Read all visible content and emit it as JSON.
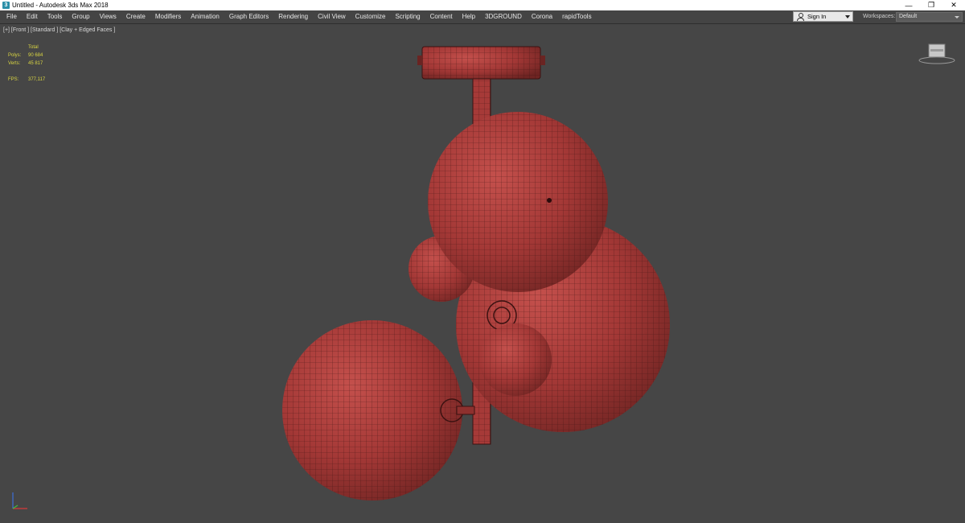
{
  "window": {
    "title": "Untitled - Autodesk 3ds Max 2018",
    "icon": "3ds-max-app-icon",
    "controls": [
      "minimize",
      "restore",
      "close"
    ]
  },
  "menubar": {
    "items": [
      "File",
      "Edit",
      "Tools",
      "Group",
      "Views",
      "Create",
      "Modifiers",
      "Animation",
      "Graph Editors",
      "Rendering",
      "Civil View",
      "Customize",
      "Scripting",
      "Content",
      "Help",
      "3DGROUND",
      "Corona",
      "rapidTools"
    ],
    "sign_in": "Sign In",
    "workspaces_label": "Workspaces:",
    "workspaces_value": "Default"
  },
  "viewport": {
    "label": "[+] [Front ] [Standard ] [Clay + Edged Faces ]",
    "stats": {
      "header": "Total",
      "polys_label": "Polys:",
      "polys_value": "90 684",
      "verts_label": "Verts:",
      "verts_value": "45 817",
      "fps_label": "FPS:",
      "fps_value": "377,117"
    },
    "model_color": "#a63a38",
    "background_color": "#464646"
  }
}
